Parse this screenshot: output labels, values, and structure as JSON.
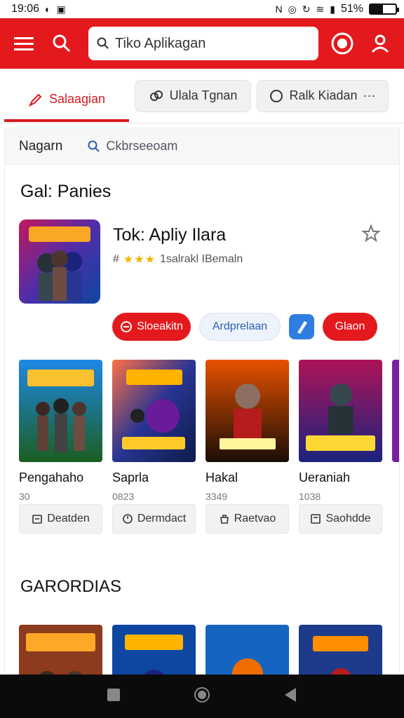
{
  "status_bar": {
    "time": "19:06",
    "battery": "51%",
    "battery_level": 0.51
  },
  "header": {
    "search_placeholder": "Tiko Aplikagan",
    "accent": "#e3191e"
  },
  "tabs": [
    {
      "label": "Salaagian",
      "icon": "pencil-icon"
    },
    {
      "label": "Ulala Tgnan",
      "icon": "link-icon"
    },
    {
      "label": "Ralk Kiadan",
      "icon": "circle-icon",
      "extra": "···"
    }
  ],
  "sub_bar": {
    "label": "Nagarn",
    "search_label": "Ckbrseeoam"
  },
  "section1": {
    "title": "Gal: Panies"
  },
  "featured": {
    "title": "Tok: Apliy Ilara",
    "rating_prefix": "#",
    "stars": "★★★",
    "rating_text": "1salrakl IBemaln",
    "rating_value": 3,
    "actions": [
      "Sloeakitn",
      "Ardprelaan",
      "Glaon"
    ]
  },
  "games": [
    {
      "name": "Pengahaho",
      "count": "30"
    },
    {
      "name": "Saprla",
      "count": "0823"
    },
    {
      "name": "Hakal",
      "count": "3349"
    },
    {
      "name": "Ueraniah",
      "count": "1038"
    }
  ],
  "chips": [
    "Deatden",
    "Dermdact",
    "Raetvao",
    "Saohdde"
  ],
  "section2": {
    "title": "GARORDIAS"
  }
}
